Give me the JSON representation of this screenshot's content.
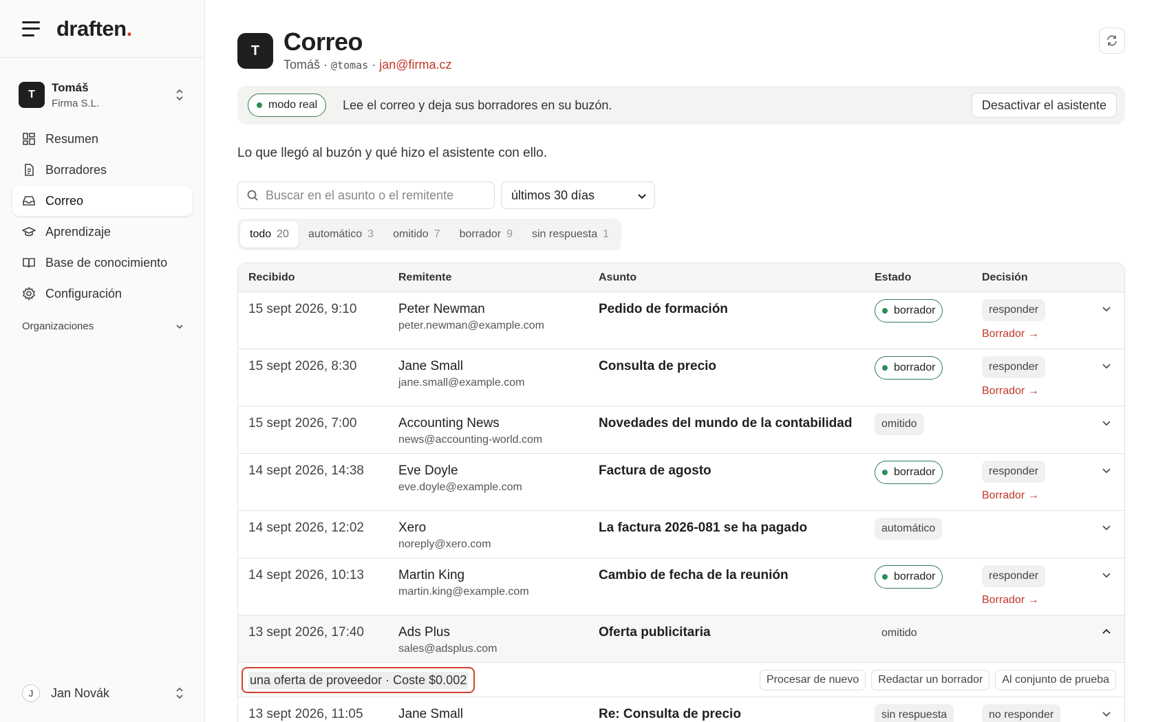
{
  "sidebar": {
    "brand": {
      "name": "draften",
      "dot": ".",
      "accent": "#d2432c"
    },
    "account": {
      "initial": "T",
      "name": "Tomáš",
      "org": "Firma S.L."
    },
    "nav": [
      {
        "label": "Resumen",
        "icon": "dashboard-icon"
      },
      {
        "label": "Borradores",
        "icon": "document-icon"
      },
      {
        "label": "Correo",
        "icon": "inbox-icon",
        "active": true
      },
      {
        "label": "Aprendizaje",
        "icon": "graduation-cap-icon"
      },
      {
        "label": "Base de conocimiento",
        "icon": "book-icon"
      },
      {
        "label": "Configuración",
        "icon": "gear-icon"
      }
    ],
    "orgs_label": "Organizaciones",
    "user": {
      "initial": "J",
      "name": "Jan Novák"
    }
  },
  "header": {
    "initial": "T",
    "title": "Correo",
    "name": "Tomáš",
    "sep1": " · ",
    "handle": "@tomas",
    "sep2": " · ",
    "email": "jan@firma.cz"
  },
  "banner": {
    "mode_label": "modo real",
    "text": "Lee el correo y deja sus borradores en su buzón.",
    "deactivate_label": "Desactivar el asistente"
  },
  "intro": "Lo que llegó al buzón y qué hizo el asistente con ello.",
  "search": {
    "placeholder": "Buscar en el asunto o el remitente",
    "value": ""
  },
  "period": {
    "selected": "últimos 30 días"
  },
  "filters": [
    {
      "label": "todo",
      "count": "20",
      "active": true
    },
    {
      "label": "automático",
      "count": "3"
    },
    {
      "label": "omitido",
      "count": "7"
    },
    {
      "label": "borrador",
      "count": "9"
    },
    {
      "label": "sin respuesta",
      "count": "1"
    }
  ],
  "table": {
    "headers": {
      "received": "Recibido",
      "sender": "Remitente",
      "subject": "Asunto",
      "state": "Estado",
      "decision": "Decisión"
    },
    "rows": [
      {
        "received": "15 sept 2026, 9:10",
        "sender": "Peter Newman",
        "email": "peter.newman@example.com",
        "subject": "Pedido de formación",
        "state": "borrador",
        "decision": "responder",
        "link": "Borrador →"
      },
      {
        "received": "15 sept 2026, 8:30",
        "sender": "Jane Small",
        "email": "jane.small@example.com",
        "subject": "Consulta de precio",
        "state": "borrador",
        "decision": "responder",
        "link": "Borrador →"
      },
      {
        "received": "15 sept 2026, 7:00",
        "sender": "Accounting News",
        "email": "news@accounting-world.com",
        "subject": "Novedades del mundo de la contabilidad",
        "state": "omitido"
      },
      {
        "received": "14 sept 2026, 14:38",
        "sender": "Eve Doyle",
        "email": "eve.doyle@example.com",
        "subject": "Factura de agosto",
        "state": "borrador",
        "decision": "responder",
        "link": "Borrador →"
      },
      {
        "received": "14 sept 2026, 12:02",
        "sender": "Xero",
        "email": "noreply@xero.com",
        "subject": "La factura 2026-081 se ha pagado",
        "state": "automático"
      },
      {
        "received": "14 sept 2026, 10:13",
        "sender": "Martin King",
        "email": "martin.king@example.com",
        "subject": "Cambio de fecha de la reunión",
        "state": "borrador",
        "decision": "responder",
        "link": "Borrador →"
      },
      {
        "received": "13 sept 2026, 17:40",
        "sender": "Ads Plus",
        "email": "sales@adsplus.com",
        "subject": "Oferta publicitaria",
        "state": "omitido",
        "expanded": true
      },
      {
        "received": "13 sept 2026, 11:05",
        "sender": "Jane Small",
        "email": "",
        "subject": "Re: Consulta de precio",
        "state": "sin respuesta",
        "decision": "no responder"
      }
    ],
    "detail": {
      "note": "una oferta de proveedor · Coste $0.002",
      "actions": [
        "Procesar de nuevo",
        "Redactar un borrador",
        "Al conjunto de prueba"
      ]
    }
  }
}
